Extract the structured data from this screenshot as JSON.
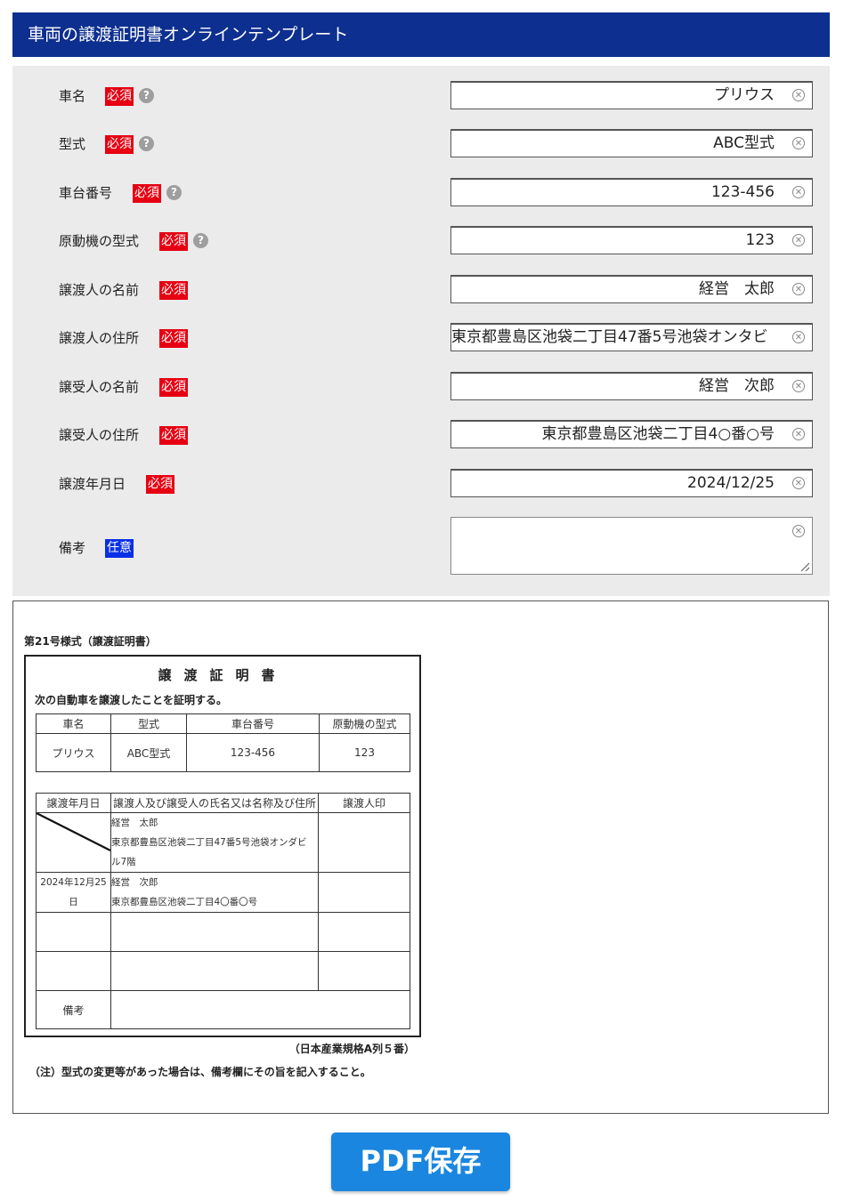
{
  "header": {
    "title": "車両の譲渡証明書オンラインテンプレート"
  },
  "badges": {
    "required": "必須",
    "optional": "任意"
  },
  "fields": [
    {
      "label": "車名",
      "value": "プリウス"
    },
    {
      "label": "型式",
      "value": "ABC型式"
    },
    {
      "label": "車台番号",
      "value": "123-456"
    },
    {
      "label": "原動機の型式",
      "value": "123"
    },
    {
      "label": "譲渡人の名前",
      "value": "経営　太郎"
    },
    {
      "label": "譲渡人の住所",
      "value": "東京都豊島区池袋二丁目47番5号池袋オンタビ"
    },
    {
      "label": "譲受人の名前",
      "value": "経営　次郎"
    },
    {
      "label": "譲受人の住所",
      "value": "東京都豊島区池袋二丁目4○番○号"
    },
    {
      "label": "譲渡年月日",
      "value": "2024/12/25"
    },
    {
      "label": "備考",
      "value": ""
    }
  ],
  "preview": {
    "form_no": "第21号様式（譲渡証明書）",
    "title": "譲渡証明書",
    "subtitle": "次の自動車を譲渡したことを証明する。",
    "vehicle_headers": [
      "車名",
      "型式",
      "車台番号",
      "原動機の型式"
    ],
    "vehicle_values": [
      "プリウス",
      "ABC型式",
      "123-456",
      "123"
    ],
    "transfer_headers": [
      "譲渡年月日",
      "譲渡人及び譲受人の氏名又は名称及び住所",
      "譲渡人印"
    ],
    "transferor_name": "経営　太郎",
    "transferor_address_1": "東京都豊島区池袋二丁目47番5号池袋オンダビ",
    "transferor_address_2": "ル7階",
    "transfer_date_1": "2024年12月25",
    "transfer_date_2": "日",
    "transferee_name": "経営　次郎",
    "transferee_address": "東京都豊島区池袋二丁目4〇番〇号",
    "remarks_label": "備考",
    "jis": "（日本産業規格A列５番）",
    "note": "（注）型式の変更等があった場合は、備考欄にその旨を記入すること。"
  },
  "actions": {
    "pdf_save": "PDF保存"
  },
  "colors": {
    "header": "#0d2f8f",
    "required": "#e60012",
    "optional": "#0a2fe6",
    "button": "#1a86e0"
  }
}
